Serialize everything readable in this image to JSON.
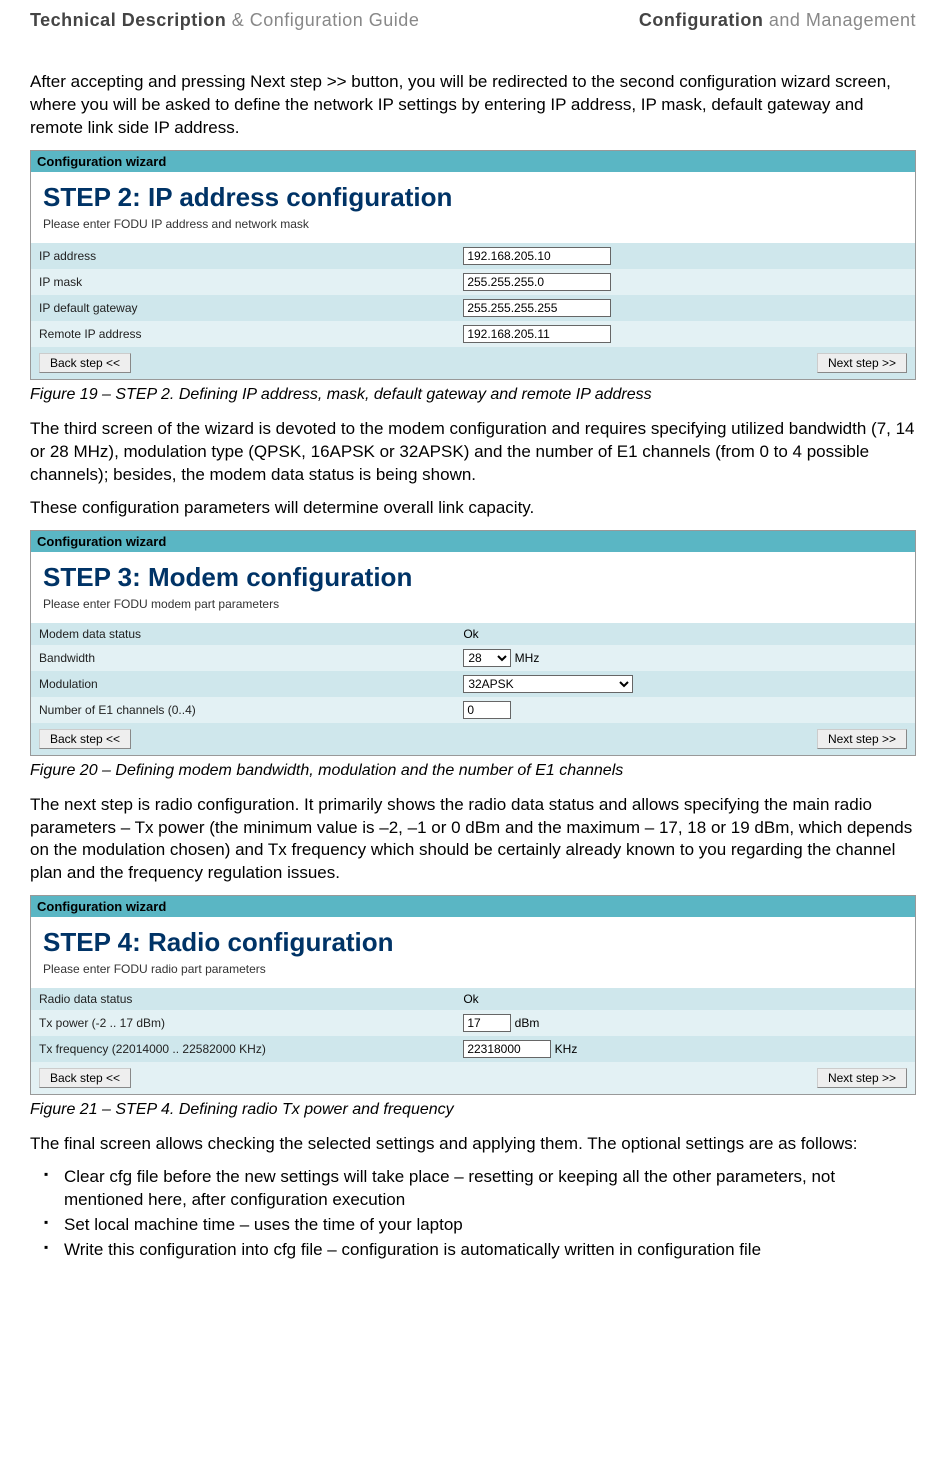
{
  "header": {
    "left_bold": "Technical Description",
    "left_light": " & Configuration Guide",
    "right_bold": "Configuration",
    "right_light": " and Management"
  },
  "p1": "After accepting and pressing Next step >> button, you will be redirected to the second configuration wizard screen, where you will be asked to define the network IP settings by entering IP address, IP mask, default gateway and remote link side IP address.",
  "wiz1": {
    "bar": "Configuration wizard",
    "title": "STEP 2: IP address configuration",
    "sub": "Please enter FODU IP address and network mask",
    "rows": [
      {
        "label": "IP address",
        "value": "192.168.205.10"
      },
      {
        "label": "IP mask",
        "value": "255.255.255.0"
      },
      {
        "label": "IP default gateway",
        "value": "255.255.255.255"
      },
      {
        "label": "Remote IP address",
        "value": "192.168.205.11"
      }
    ],
    "back": "Back step <<",
    "next": "Next step >>"
  },
  "cap1": "Figure 19 – STEP 2. Defining IP address, mask, default gateway and remote IP address",
  "p2": "The third screen of the wizard is devoted to the modem configuration and requires specifying utilized bandwidth (7, 14 or 28 MHz), modulation type (QPSK, 16APSK or 32APSK) and the number of E1 channels (from 0 to 4 possible channels); besides, the modem data status is being shown.",
  "p3": "These configuration parameters will determine overall link capacity.",
  "wiz2": {
    "bar": "Configuration wizard",
    "title": "STEP 3: Modem configuration",
    "sub": "Please enter FODU modem part parameters",
    "status_label": "Modem data status",
    "status_value": "Ok",
    "bw_label": "Bandwidth",
    "bw_value": "28",
    "bw_unit": "MHz",
    "mod_label": "Modulation",
    "mod_value": "32APSK",
    "e1_label": "Number of E1 channels (0..4)",
    "e1_value": "0",
    "back": "Back step <<",
    "next": "Next step >>"
  },
  "cap2": "Figure 20 –  Defining modem bandwidth, modulation and the number of E1 channels",
  "p4": "The next step is radio configuration. It primarily shows the radio data status and allows specifying the main radio parameters – Tx power (the minimum value is –2, –1 or 0 dBm and the maximum – 17, 18 or 19 dBm, which depends on the modulation chosen) and Tx frequency which should be certainly already known to you regarding the channel plan and the frequency regulation issues.",
  "wiz3": {
    "bar": "Configuration wizard",
    "title": "STEP 4: Radio configuration",
    "sub": "Please enter FODU radio part parameters",
    "status_label": "Radio data status",
    "status_value": "Ok",
    "txp_label": "Tx power (-2 .. 17 dBm)",
    "txp_value": "17",
    "txp_unit": "dBm",
    "txf_label": "Tx frequency (22014000 .. 22582000 KHz)",
    "txf_value": "22318000",
    "txf_unit": "KHz",
    "back": "Back step <<",
    "next": "Next step >>"
  },
  "cap3": "Figure 21 – STEP 4. Defining radio Tx power and frequency",
  "p5": "The final screen allows checking the selected settings and applying them. The optional settings are as follows:",
  "bullets": [
    "Clear cfg file before the new settings will take place – resetting or keeping all the other parameters, not mentioned here, after configuration execution",
    "Set local machine time – uses the time of your laptop",
    "Write this configuration into cfg file – configuration is automatically written in configuration file"
  ]
}
